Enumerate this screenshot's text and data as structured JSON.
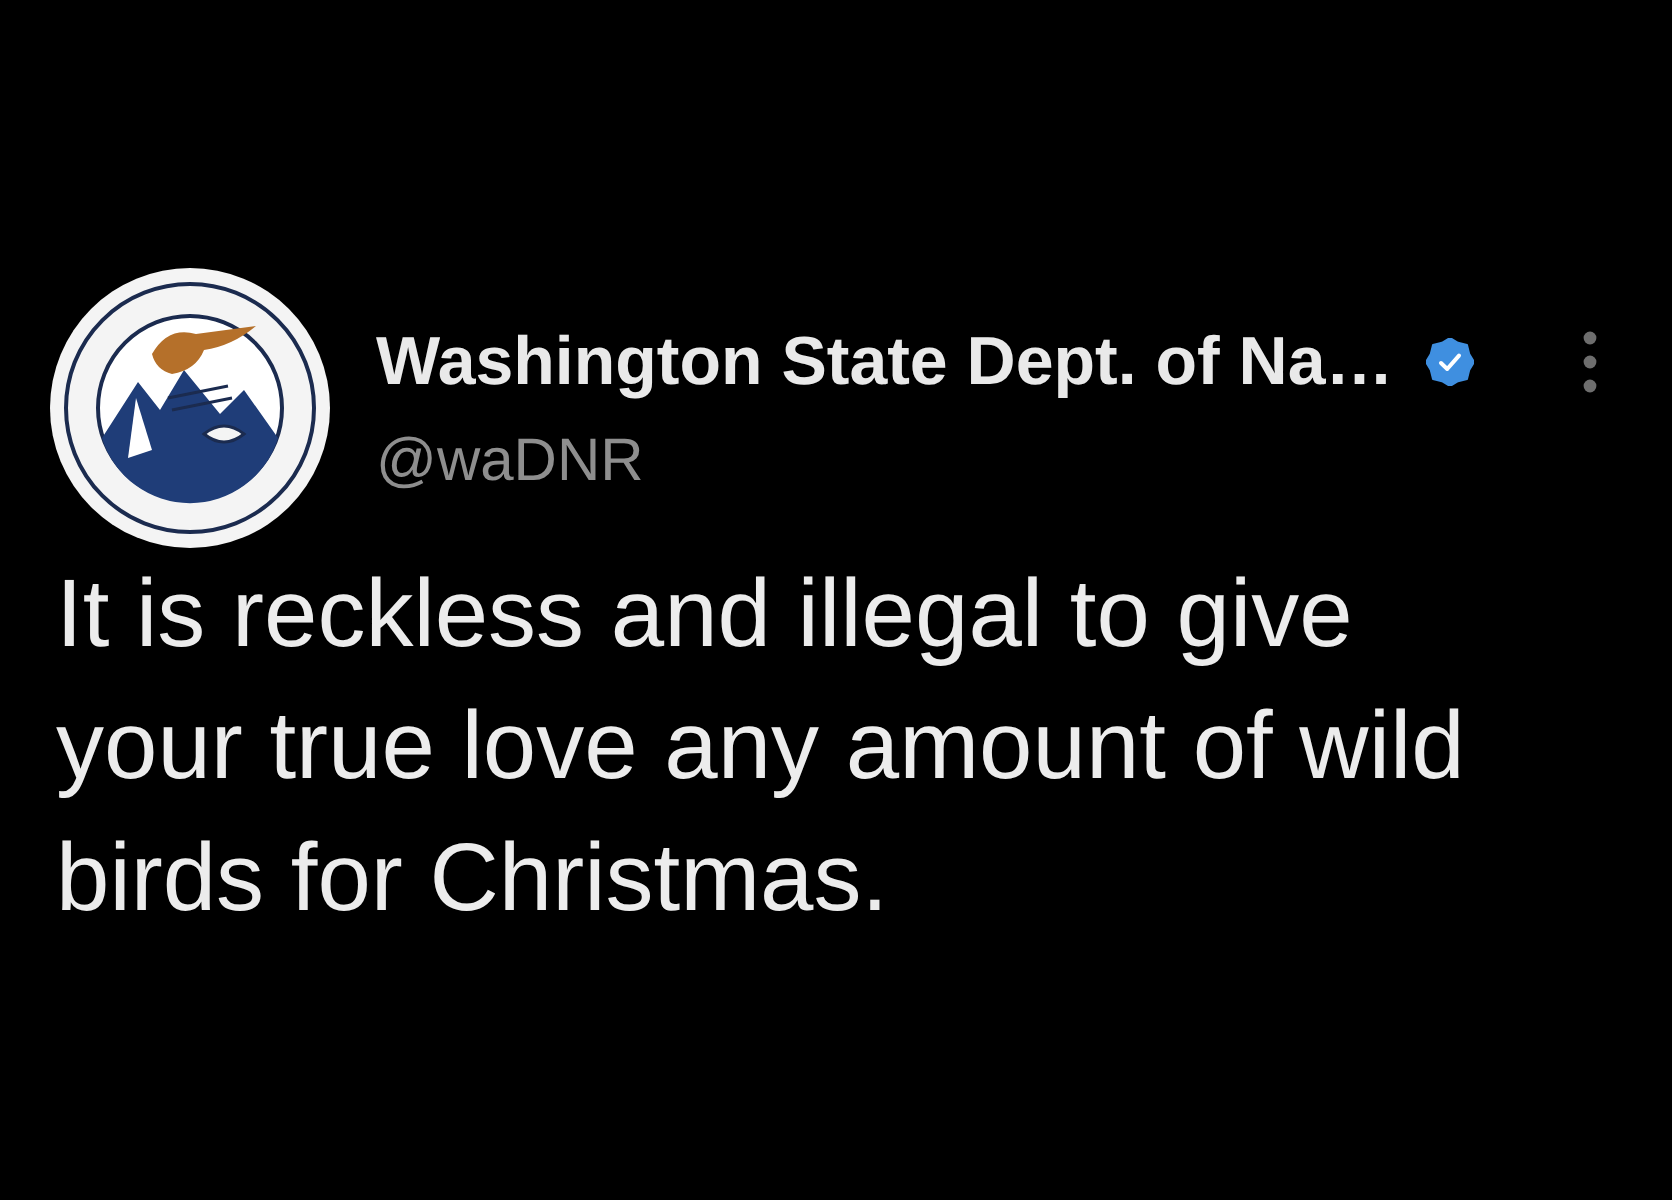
{
  "post": {
    "author": {
      "name": "Washington State Dept. of Na…",
      "handle": "@waDNR",
      "verified": true
    },
    "text": "It is reckless and illegal to give your true love any amount of wild birds for Christmas."
  }
}
